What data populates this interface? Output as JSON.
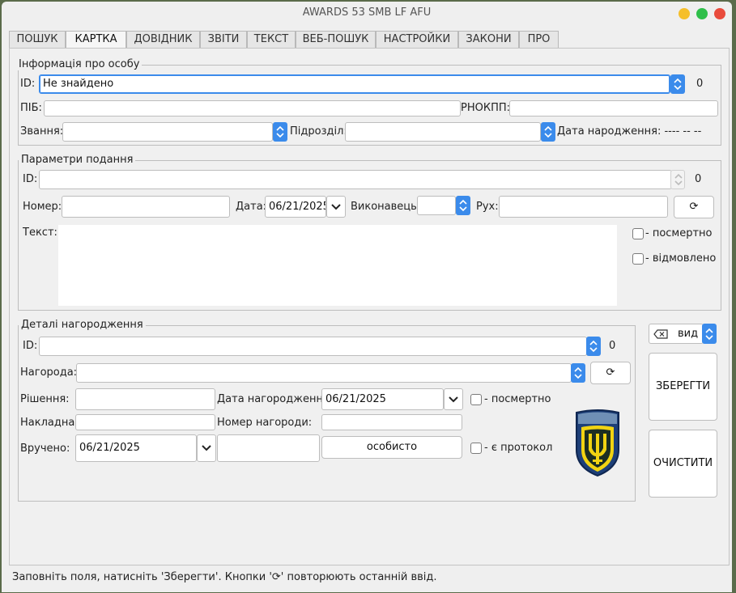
{
  "window": {
    "title": "AWARDS 53 SMB LF AFU"
  },
  "tabs": [
    "ПОШУК",
    "КАРТКА",
    "ДОВІДНИК",
    "ЗВІТИ",
    "ТЕКСТ",
    "ВЕБ-ПОШУК",
    "НАСТРОЙКИ",
    "ЗАКОНИ",
    "ПРО"
  ],
  "person": {
    "group_title": "Інформація про особу",
    "id_label": "ID:",
    "id_value": "Не знайдено",
    "count": "0",
    "pib_label": "ПІБ:",
    "pib_value": "",
    "rnokpp_label": "РНОКПП:",
    "rnokpp_value": "",
    "rank_label": "Звання:",
    "rank_value": "",
    "unit_label": "Підрозділ:",
    "unit_value": "",
    "birth_label": "Дата народження: ---- -- --"
  },
  "submission": {
    "group_title": "Параметри подання",
    "id_label": "ID:",
    "id_value": "",
    "count": "0",
    "number_label": "Номер:",
    "number_value": "",
    "date_label": "Дата:",
    "date_value": "06/21/2025",
    "executor_label": "Виконавець:",
    "executor_value": "",
    "movement_label": "Рух:",
    "movement_value": "",
    "repeat_icon": "⟳",
    "text_label": "Текст:",
    "text_value": "",
    "posthumous_label": "- посмертно",
    "denied_label": "- відмовлено"
  },
  "award": {
    "group_title": "Деталі нагородження",
    "id_label": "ID:",
    "id_value": "",
    "count": "0",
    "award_label": "Нагорода:",
    "award_value": "",
    "repeat_icon": "⟳",
    "decision_label": "Рішення:",
    "decision_value": "",
    "award_date_label": "Дата нагородження:",
    "award_date_value": "06/21/2025",
    "posthumous_label": "- посмертно",
    "waybill_label": "Накладна:",
    "waybill_value": "",
    "award_number_label": "Номер нагороди:",
    "award_number_value": "",
    "handed_label": "Вручено:",
    "handed_date": "06/21/2025",
    "handed_extra": "",
    "personally_button": "особисто",
    "protocol_label": "- є протокол"
  },
  "side": {
    "view_label": "вид",
    "save_button": "ЗБЕРЕГТИ",
    "clear_button": "ОЧИСТИТИ"
  },
  "status_bar": "Заповніть поля, натисніть 'Зберегти'. Кнопки '⟳' повторюють останній ввід.",
  "colors": {
    "accent": "#3b8beb",
    "close": "#e94b3c",
    "minimize": "#f5bf2a",
    "maximize": "#2fbf4a",
    "emblem": "#f1d312"
  }
}
